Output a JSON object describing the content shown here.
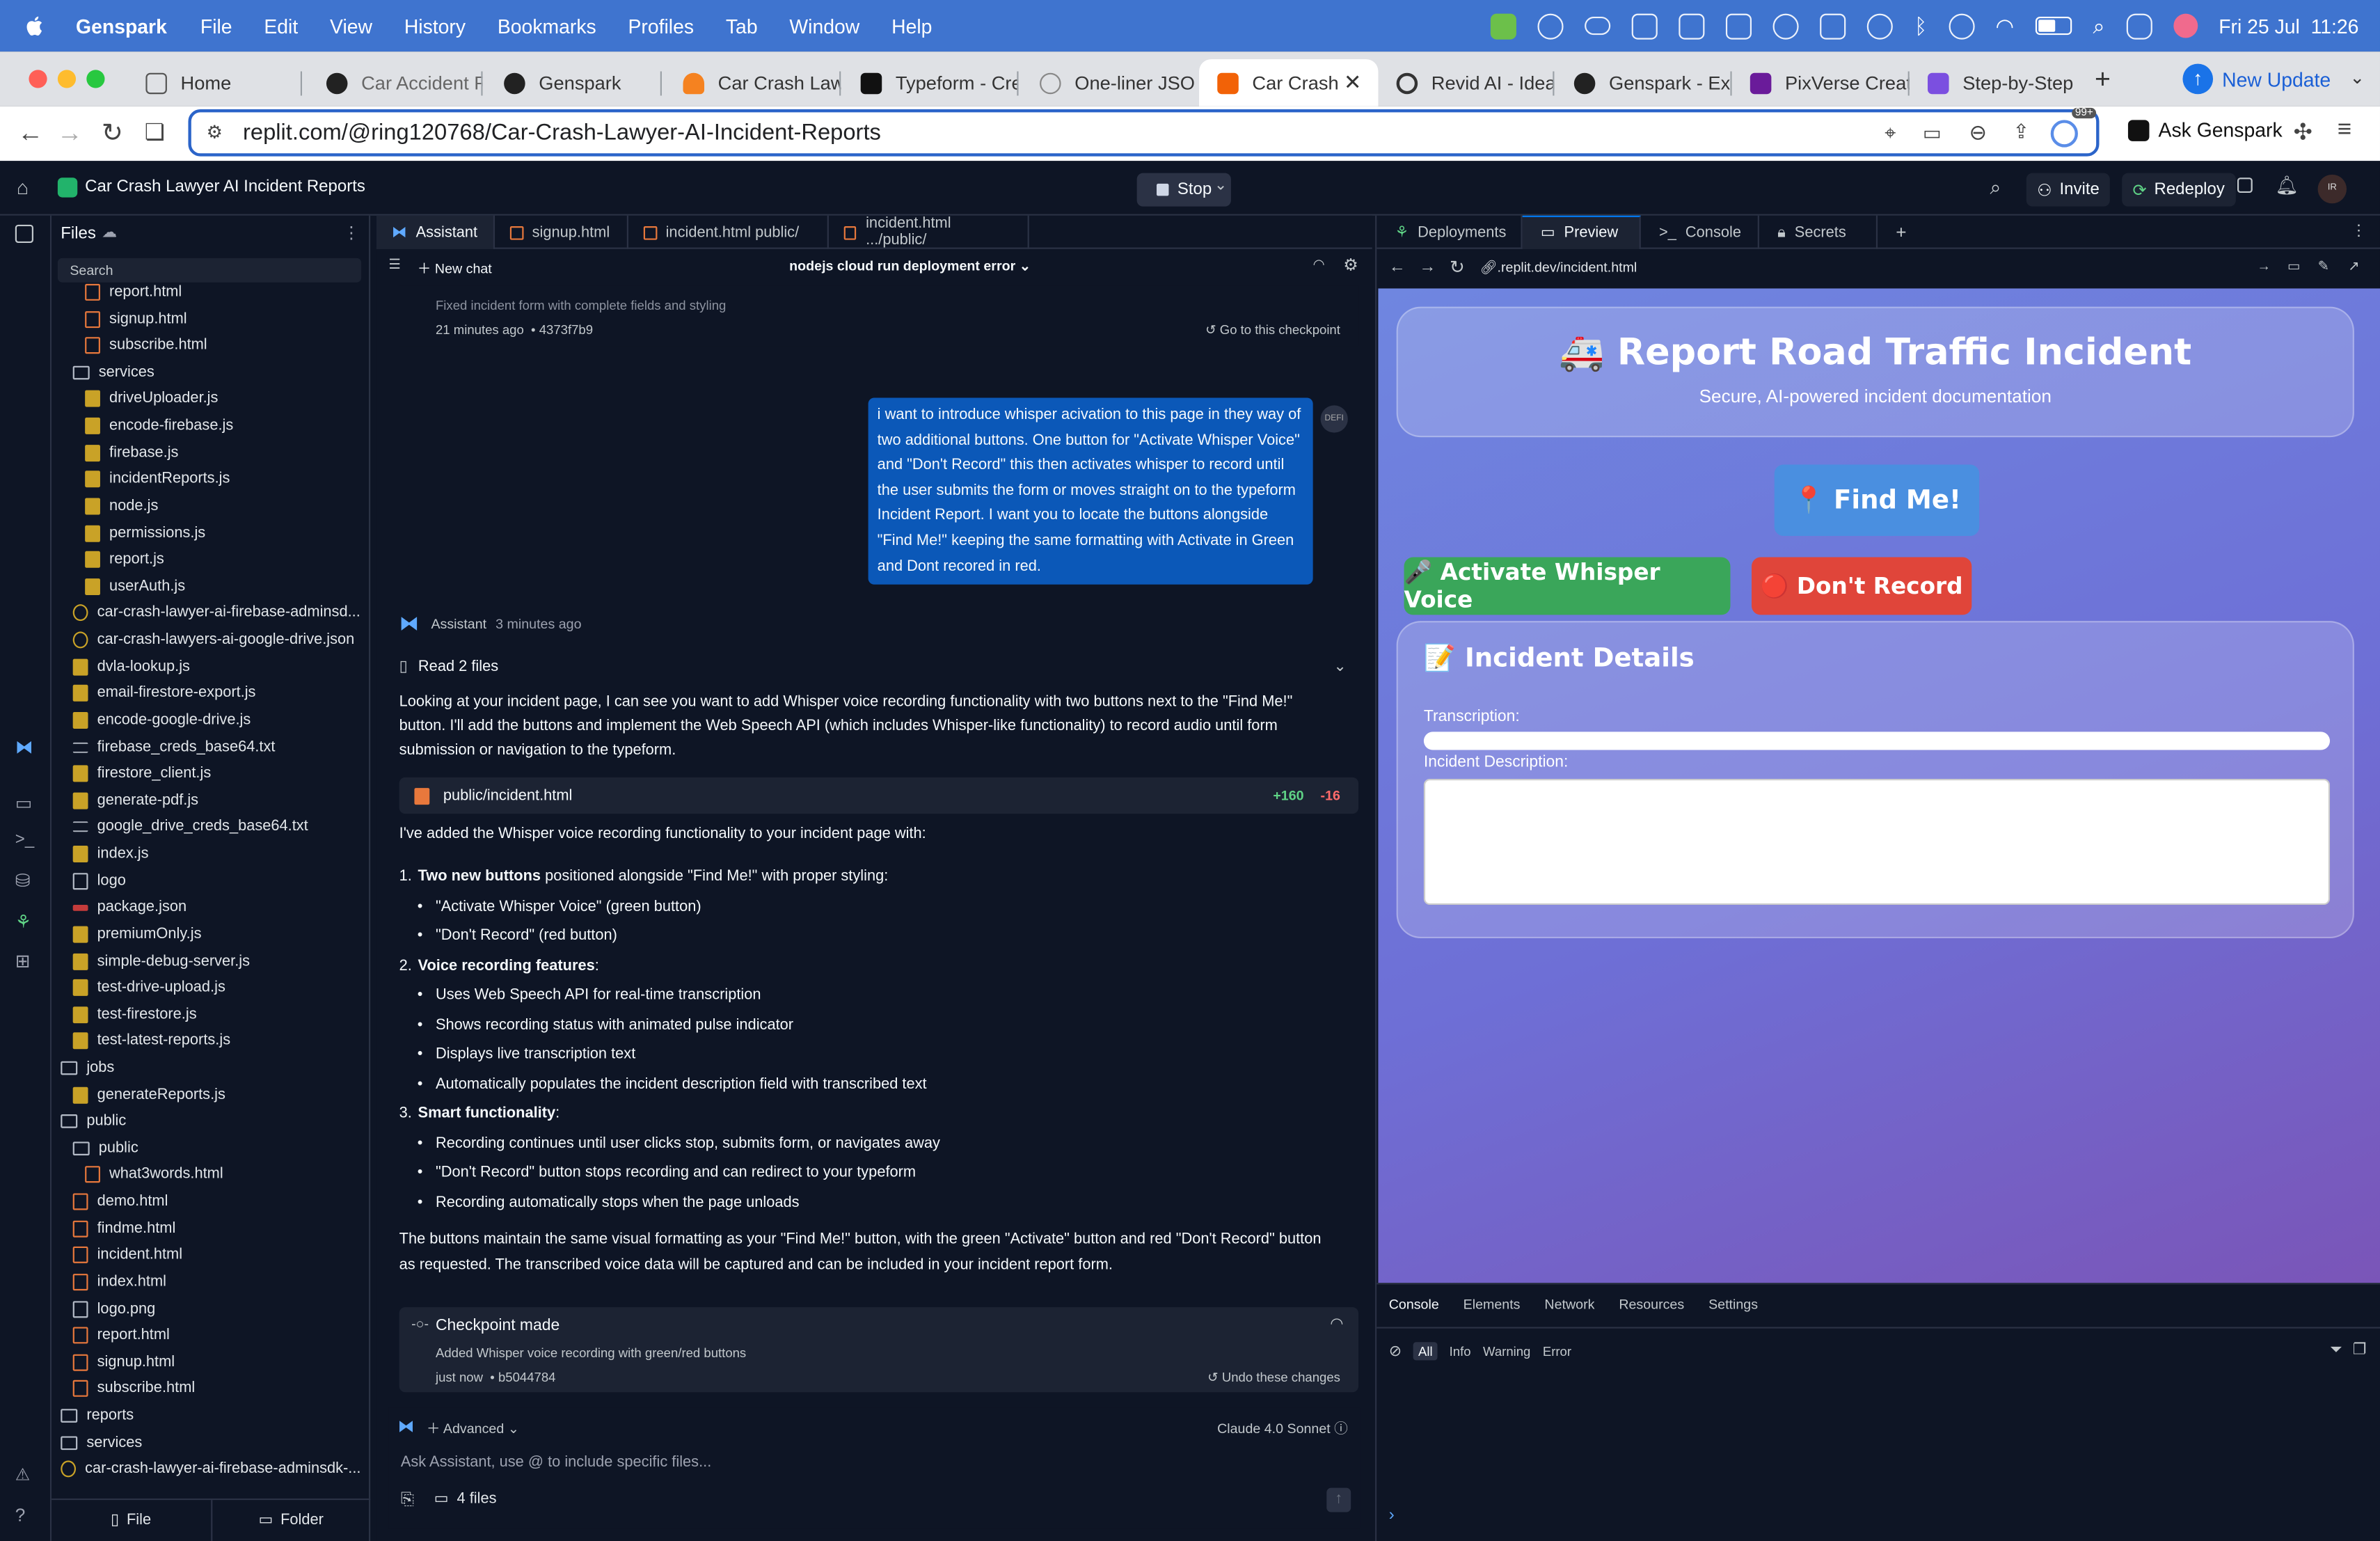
{
  "menubar": {
    "app_name": "Genspark",
    "menus": [
      "File",
      "Edit",
      "View",
      "History",
      "Bookmarks",
      "Profiles",
      "Tab",
      "Window",
      "Help"
    ],
    "datetime": "Fri 25 Jul  11:26"
  },
  "browser_tabs": [
    {
      "label": "Home",
      "icon": "home-icon"
    },
    {
      "label": "Car Accident R",
      "icon": "genspark-icon"
    },
    {
      "label": "Genspark",
      "icon": "genspark-icon"
    },
    {
      "label": "Car Crash Law",
      "icon": "firebase-icon"
    },
    {
      "label": "Typeform - Cre",
      "icon": "typeform-icon"
    },
    {
      "label": "One-liner JSO",
      "icon": "globe-icon"
    },
    {
      "label": "Car Crash",
      "icon": "replit-icon",
      "active": true
    },
    {
      "label": "Revid AI - Idea",
      "icon": "revid-icon"
    },
    {
      "label": "Genspark - Ex",
      "icon": "genspark-icon"
    },
    {
      "label": "PixVerse Creat",
      "icon": "pixverse-icon"
    },
    {
      "label": "Step-by-Step",
      "icon": "step-icon"
    }
  ],
  "new_update_label": "New Update",
  "address": {
    "url": "replit.com/@ring120768/Car-Crash-Lawyer-AI-Incident-Reports",
    "ask_label": "Ask Genspark",
    "badge": "99+"
  },
  "replit_top": {
    "project_title": "Car Crash Lawyer AI Incident Reports",
    "stop_label": "Stop",
    "invite_label": "Invite",
    "redeploy_label": "Redeploy",
    "avatar_initials": "IR"
  },
  "files": {
    "header": "Files",
    "search_placeholder": "Search",
    "items": [
      {
        "name": "report.html",
        "type": "html",
        "indent": 2
      },
      {
        "name": "signup.html",
        "type": "html",
        "indent": 2
      },
      {
        "name": "subscribe.html",
        "type": "html",
        "indent": 2
      },
      {
        "name": "services",
        "type": "dir",
        "indent": 1
      },
      {
        "name": "driveUploader.js",
        "type": "js",
        "indent": 2
      },
      {
        "name": "encode-firebase.js",
        "type": "js",
        "indent": 2
      },
      {
        "name": "firebase.js",
        "type": "js",
        "indent": 2
      },
      {
        "name": "incidentReports.js",
        "type": "js",
        "indent": 2
      },
      {
        "name": "node.js",
        "type": "js",
        "indent": 2
      },
      {
        "name": "permissions.js",
        "type": "js",
        "indent": 2
      },
      {
        "name": "report.js",
        "type": "js",
        "indent": 2
      },
      {
        "name": "userAuth.js",
        "type": "js",
        "indent": 2
      },
      {
        "name": "car-crash-lawyer-ai-firebase-adminsd...",
        "type": "json",
        "indent": 1
      },
      {
        "name": "car-crash-lawyers-ai-google-drive.json",
        "type": "json",
        "indent": 1
      },
      {
        "name": "dvla-lookup.js",
        "type": "js",
        "indent": 1
      },
      {
        "name": "email-firestore-export.js",
        "type": "js",
        "indent": 1
      },
      {
        "name": "encode-google-drive.js",
        "type": "js",
        "indent": 1
      },
      {
        "name": "firebase_creds_base64.txt",
        "type": "txt",
        "indent": 1
      },
      {
        "name": "firestore_client.js",
        "type": "js",
        "indent": 1
      },
      {
        "name": "generate-pdf.js",
        "type": "js",
        "indent": 1
      },
      {
        "name": "google_drive_creds_base64.txt",
        "type": "txt",
        "indent": 1
      },
      {
        "name": "index.js",
        "type": "js",
        "indent": 1
      },
      {
        "name": "logo",
        "type": "img",
        "indent": 1
      },
      {
        "name": "package.json",
        "type": "pkg",
        "indent": 1
      },
      {
        "name": "premiumOnly.js",
        "type": "js",
        "indent": 1
      },
      {
        "name": "simple-debug-server.js",
        "type": "js",
        "indent": 1
      },
      {
        "name": "test-drive-upload.js",
        "type": "js",
        "indent": 1
      },
      {
        "name": "test-firestore.js",
        "type": "js",
        "indent": 1
      },
      {
        "name": "test-latest-reports.js",
        "type": "js",
        "indent": 1
      },
      {
        "name": "jobs",
        "type": "dir",
        "indent": 0
      },
      {
        "name": "generateReports.js",
        "type": "js",
        "indent": 1
      },
      {
        "name": "public",
        "type": "dir",
        "indent": 0
      },
      {
        "name": "public",
        "type": "dir",
        "indent": 1
      },
      {
        "name": "what3words.html",
        "type": "html",
        "indent": 2
      },
      {
        "name": "demo.html",
        "type": "html",
        "indent": 1
      },
      {
        "name": "findme.html",
        "type": "html",
        "indent": 1
      },
      {
        "name": "incident.html",
        "type": "html",
        "indent": 1
      },
      {
        "name": "index.html",
        "type": "html",
        "indent": 1
      },
      {
        "name": "logo.png",
        "type": "img",
        "indent": 1
      },
      {
        "name": "report.html",
        "type": "html",
        "indent": 1
      },
      {
        "name": "signup.html",
        "type": "html",
        "indent": 1
      },
      {
        "name": "subscribe.html",
        "type": "html",
        "indent": 1
      },
      {
        "name": "reports",
        "type": "dir",
        "indent": 0
      },
      {
        "name": "services",
        "type": "dir",
        "indent": 0
      },
      {
        "name": "car-crash-lawyer-ai-firebase-adminsdk-...",
        "type": "json",
        "indent": 0
      }
    ],
    "footer_file": "File",
    "footer_folder": "Folder"
  },
  "editor_tabs": [
    {
      "label": "Assistant",
      "active": true
    },
    {
      "label": "signup.html"
    },
    {
      "label": "incident.html public/"
    },
    {
      "label": "incident.html .../public/"
    }
  ],
  "chat": {
    "new_chat": "New chat",
    "thread_title": "nodejs cloud run deployment error",
    "prev_checkpoint_desc": "Fixed incident form with complete fields and styling",
    "prev_checkpoint_time": "21 minutes ago",
    "prev_checkpoint_hash": "4373f7b9",
    "goto_checkpoint": "Go to this checkpoint",
    "user_message": "i want to introduce whisper acivation to this page in they way of two additional buttons. One button for \"Activate Whisper Voice\" and \"Don't Record\" this then activates whisper to record until the user submits the form or moves straight on to the typeform Incident Report. I want you to locate the buttons alongside \"Find Me!\" keeping the same formatting with Activate in Green and Dont recored in red.",
    "user_avatar": "DEFI",
    "assistant_name": "Assistant",
    "assistant_time": "3 minutes ago",
    "read_files": "Read 2 files",
    "intro": "Looking at your incident page, I can see you want to add Whisper voice recording functionality with two buttons next to the \"Find Me!\" button. I'll add the buttons and implement the Web Speech API (which includes Whisper-like functionality) to record audio until form submission or navigation to the typeform.",
    "file_ref": "public/incident.html",
    "added": "+160",
    "removed": "-16",
    "summary_intro": "I've added the Whisper voice recording functionality to your incident page with:",
    "sections": [
      {
        "num": "1.",
        "title": "Two new buttons",
        "rest": " positioned alongside \"Find Me!\" with proper styling:",
        "bullets": [
          "\"Activate Whisper Voice\" (green button)",
          "\"Don't Record\" (red button)"
        ]
      },
      {
        "num": "2.",
        "title": "Voice recording features",
        "rest": ":",
        "bullets": [
          "Uses Web Speech API for real-time transcription",
          "Shows recording status with animated pulse indicator",
          "Displays live transcription text",
          "Automatically populates the incident description field with transcribed text"
        ]
      },
      {
        "num": "3.",
        "title": "Smart functionality",
        "rest": ":",
        "bullets": [
          "Recording continues until user clicks stop, submits form, or navigates away",
          "\"Don't Record\" button stops recording and can redirect to your typeform",
          "Recording automatically stops when the page unloads"
        ]
      }
    ],
    "closing": "The buttons maintain the same visual formatting as your \"Find Me!\" button, with the green \"Activate\" button and red \"Don't Record\" button as requested. The transcribed voice data will be captured and can be included in your incident report form.",
    "checkpoint_title": "Checkpoint made",
    "checkpoint_desc": "Added Whisper voice recording with green/red buttons",
    "checkpoint_time": "just now",
    "checkpoint_hash": "b5044784",
    "undo_label": "Undo these changes",
    "advanced_label": "Advanced",
    "model_label": "Claude 4.0 Sonnet",
    "composer_placeholder": "Ask Assistant, use @ to include specific files...",
    "files_count": "4 files"
  },
  "right_tabs": [
    {
      "label": "Deployments"
    },
    {
      "label": "Preview",
      "active": true
    },
    {
      "label": "Console"
    },
    {
      "label": "Secrets"
    }
  ],
  "preview": {
    "url": ".replit.dev/incident.html",
    "title": "🚑 Report Road Traffic Incident",
    "subtitle": "Secure, AI-powered incident documentation",
    "find_me": "📍 Find Me!",
    "activate": "🎤 Activate Whisper Voice",
    "dont_record": "🔴 Don't Record",
    "details_title": "📝 Incident Details",
    "transcription_label": "Transcription:",
    "description_label": "Incident Description:",
    "colors": {
      "green": "#3aa65a",
      "red": "#e0453a",
      "blue": "#4a8fe0"
    }
  },
  "devtools": {
    "tabs": [
      "Console",
      "Elements",
      "Network",
      "Resources",
      "Settings"
    ],
    "filters": [
      "All",
      "Info",
      "Warning",
      "Error"
    ]
  }
}
